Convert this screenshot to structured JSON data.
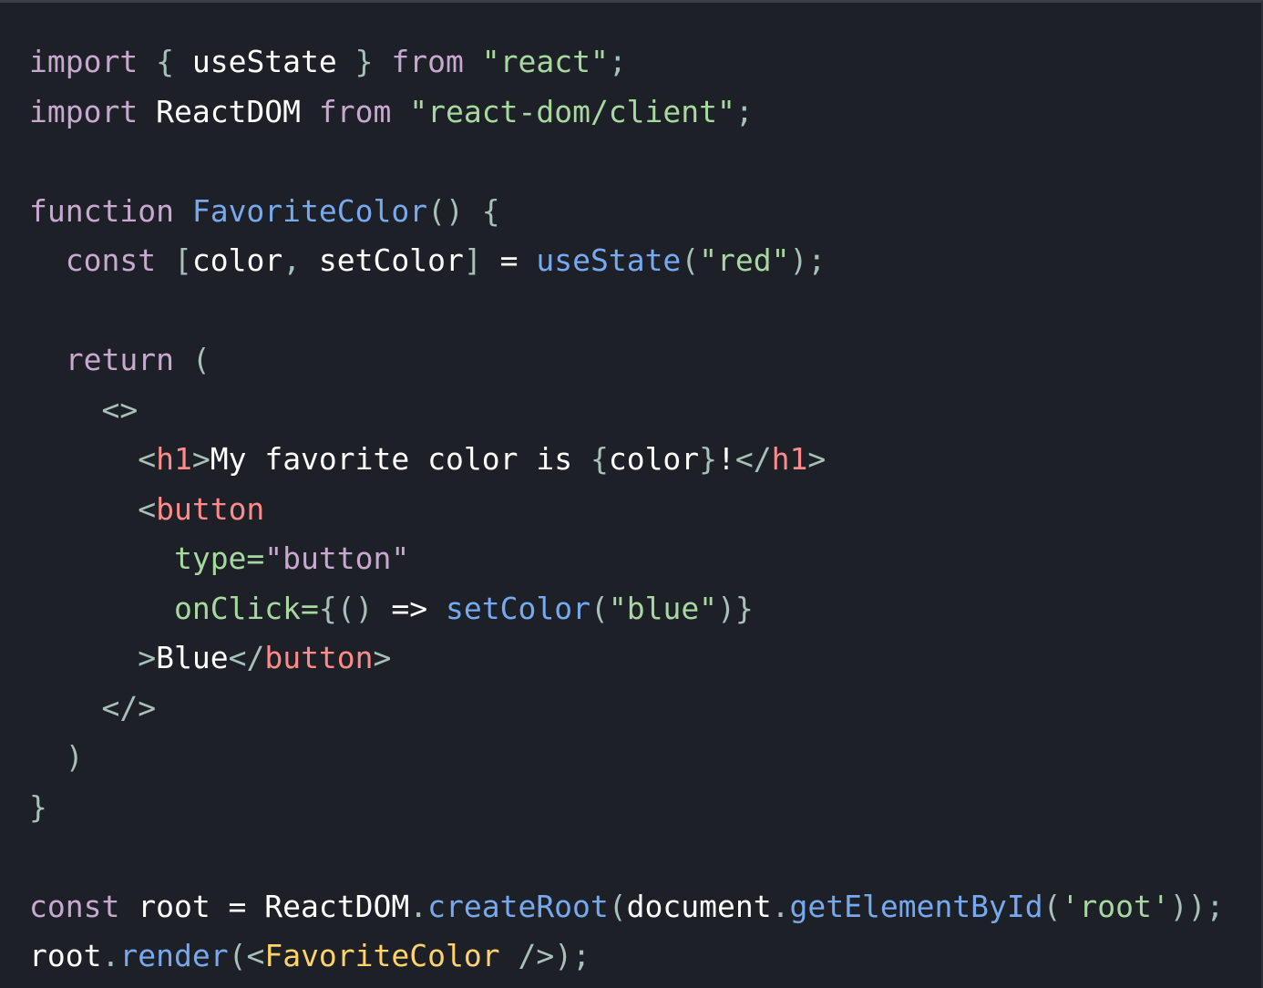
{
  "colors": {
    "background": "#1d2127",
    "plain": "#ffffff",
    "keyword": "#c7a9d0",
    "string": "#a7d89f",
    "function": "#76a9f0",
    "tag": "#ff8a8a",
    "component": "#ffd26a",
    "punct": "#a7c0ba"
  },
  "code": {
    "lines": [
      [
        {
          "t": "import",
          "k": "keyword"
        },
        {
          "t": " ",
          "k": "plain"
        },
        {
          "t": "{",
          "k": "punct"
        },
        {
          "t": " useState ",
          "k": "plain"
        },
        {
          "t": "}",
          "k": "punct"
        },
        {
          "t": " ",
          "k": "plain"
        },
        {
          "t": "from",
          "k": "keyword"
        },
        {
          "t": " ",
          "k": "plain"
        },
        {
          "t": "\"react\"",
          "k": "string"
        },
        {
          "t": ";",
          "k": "punct"
        }
      ],
      [
        {
          "t": "import",
          "k": "keyword"
        },
        {
          "t": " ReactDOM ",
          "k": "plain"
        },
        {
          "t": "from",
          "k": "keyword"
        },
        {
          "t": " ",
          "k": "plain"
        },
        {
          "t": "\"react-dom/client\"",
          "k": "string"
        },
        {
          "t": ";",
          "k": "punct"
        }
      ],
      [],
      [
        {
          "t": "function",
          "k": "keyword"
        },
        {
          "t": " ",
          "k": "plain"
        },
        {
          "t": "FavoriteColor",
          "k": "function"
        },
        {
          "t": "()",
          "k": "punct"
        },
        {
          "t": " ",
          "k": "plain"
        },
        {
          "t": "{",
          "k": "punct"
        }
      ],
      [
        {
          "t": "  ",
          "k": "plain"
        },
        {
          "t": "const",
          "k": "keyword"
        },
        {
          "t": " ",
          "k": "plain"
        },
        {
          "t": "[",
          "k": "punct"
        },
        {
          "t": "color",
          "k": "plain"
        },
        {
          "t": ",",
          "k": "punct"
        },
        {
          "t": " setColor",
          "k": "plain"
        },
        {
          "t": "]",
          "k": "punct"
        },
        {
          "t": " = ",
          "k": "plain"
        },
        {
          "t": "useState",
          "k": "function"
        },
        {
          "t": "(",
          "k": "punct"
        },
        {
          "t": "\"red\"",
          "k": "string"
        },
        {
          "t": ");",
          "k": "punct"
        }
      ],
      [],
      [
        {
          "t": "  ",
          "k": "plain"
        },
        {
          "t": "return",
          "k": "keyword"
        },
        {
          "t": " ",
          "k": "plain"
        },
        {
          "t": "(",
          "k": "punct"
        }
      ],
      [
        {
          "t": "    ",
          "k": "plain"
        },
        {
          "t": "<>",
          "k": "punct"
        }
      ],
      [
        {
          "t": "      ",
          "k": "plain"
        },
        {
          "t": "<",
          "k": "punct"
        },
        {
          "t": "h1",
          "k": "tag"
        },
        {
          "t": ">",
          "k": "punct"
        },
        {
          "t": "My favorite color is ",
          "k": "plain"
        },
        {
          "t": "{",
          "k": "punct"
        },
        {
          "t": "color",
          "k": "plain"
        },
        {
          "t": "}",
          "k": "punct"
        },
        {
          "t": "!",
          "k": "plain"
        },
        {
          "t": "</",
          "k": "punct"
        },
        {
          "t": "h1",
          "k": "tag"
        },
        {
          "t": ">",
          "k": "punct"
        }
      ],
      [
        {
          "t": "      ",
          "k": "plain"
        },
        {
          "t": "<",
          "k": "punct"
        },
        {
          "t": "button",
          "k": "tag"
        }
      ],
      [
        {
          "t": "        ",
          "k": "plain"
        },
        {
          "t": "type=",
          "k": "string"
        },
        {
          "t": "\"button\"",
          "k": "keyword"
        }
      ],
      [
        {
          "t": "        ",
          "k": "plain"
        },
        {
          "t": "onClick=",
          "k": "string"
        },
        {
          "t": "{",
          "k": "punct"
        },
        {
          "t": "()",
          "k": "punct"
        },
        {
          "t": " => ",
          "k": "plain"
        },
        {
          "t": "setColor",
          "k": "function"
        },
        {
          "t": "(",
          "k": "punct"
        },
        {
          "t": "\"blue\"",
          "k": "string"
        },
        {
          "t": ")}",
          "k": "punct"
        }
      ],
      [
        {
          "t": "      ",
          "k": "plain"
        },
        {
          "t": ">",
          "k": "punct"
        },
        {
          "t": "Blue",
          "k": "plain"
        },
        {
          "t": "</",
          "k": "punct"
        },
        {
          "t": "button",
          "k": "tag"
        },
        {
          "t": ">",
          "k": "punct"
        }
      ],
      [
        {
          "t": "    ",
          "k": "plain"
        },
        {
          "t": "</>",
          "k": "punct"
        }
      ],
      [
        {
          "t": "  ",
          "k": "plain"
        },
        {
          "t": ")",
          "k": "punct"
        }
      ],
      [
        {
          "t": "}",
          "k": "punct"
        }
      ],
      [],
      [
        {
          "t": "const",
          "k": "keyword"
        },
        {
          "t": " root = ReactDOM",
          "k": "plain"
        },
        {
          "t": ".",
          "k": "punct"
        },
        {
          "t": "createRoot",
          "k": "function"
        },
        {
          "t": "(",
          "k": "punct"
        },
        {
          "t": "document",
          "k": "plain"
        },
        {
          "t": ".",
          "k": "punct"
        },
        {
          "t": "getElementById",
          "k": "function"
        },
        {
          "t": "(",
          "k": "punct"
        },
        {
          "t": "'root'",
          "k": "string"
        },
        {
          "t": "));",
          "k": "punct"
        }
      ],
      [
        {
          "t": "root",
          "k": "plain"
        },
        {
          "t": ".",
          "k": "punct"
        },
        {
          "t": "render",
          "k": "function"
        },
        {
          "t": "(<",
          "k": "punct"
        },
        {
          "t": "FavoriteColor",
          "k": "component"
        },
        {
          "t": " />",
          "k": "punct"
        },
        {
          "t": ");",
          "k": "punct"
        }
      ]
    ]
  }
}
